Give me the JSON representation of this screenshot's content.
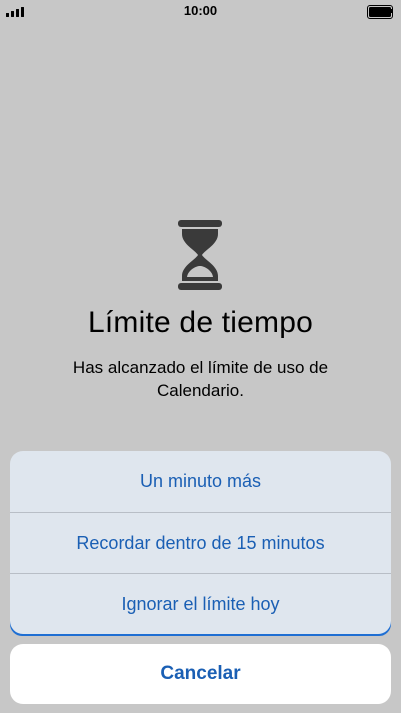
{
  "status_bar": {
    "time": "10:00",
    "signal_icon": "cellular-signal-icon",
    "battery_icon": "battery-icon",
    "battery_level": 1.0
  },
  "content": {
    "icon": "hourglass-icon",
    "title": "Límite de tiempo",
    "subtitle": "Has alcanzado el límite de uso de Calendario."
  },
  "action_sheet": {
    "options": [
      {
        "label": "Un minuto más"
      },
      {
        "label": "Recordar dentro de 15 minutos"
      },
      {
        "label": "Ignorar el límite hoy"
      }
    ],
    "cancel_label": "Cancelar",
    "accent_color": "#1a5fb4"
  }
}
